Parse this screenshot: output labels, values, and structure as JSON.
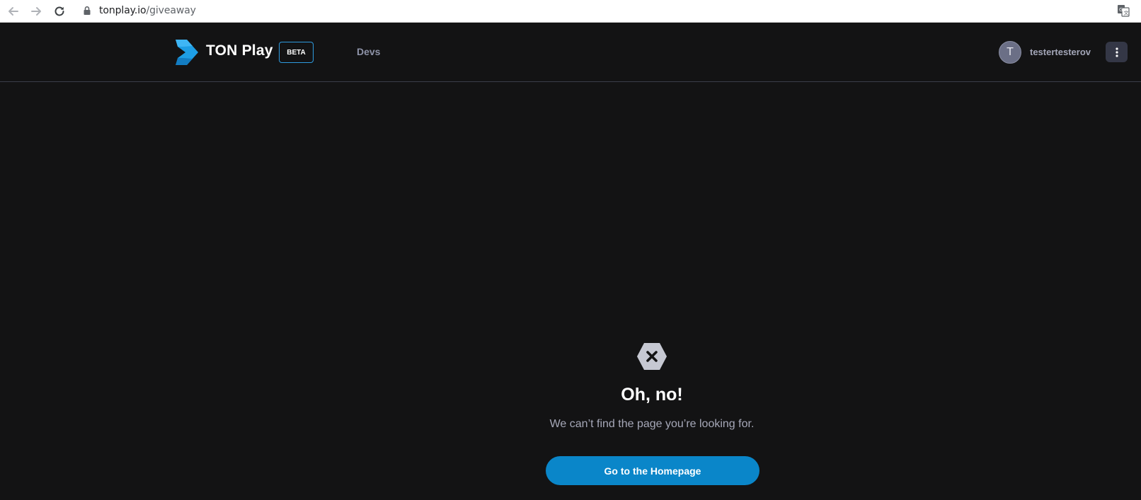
{
  "browser": {
    "url_domain": "tonplay.io",
    "url_path": "/giveaway",
    "icons": [
      "back-arrow-icon",
      "forward-arrow-icon",
      "reload-icon",
      "lock-icon",
      "translate-icon"
    ]
  },
  "header": {
    "brand": "TON Play",
    "badge": "BETA",
    "nav": {
      "devs": "Devs"
    },
    "user": {
      "avatar_initial": "T",
      "username": "testertesterov"
    }
  },
  "error": {
    "title": "Oh, no!",
    "message": "We can’t find the page you’re looking for.",
    "button_label": "Go to the Homepage"
  },
  "colors": {
    "background": "#131314",
    "accent": "#0a86c9",
    "brand_blue": "#2f9bdf",
    "muted_text": "#a6a8b8"
  }
}
